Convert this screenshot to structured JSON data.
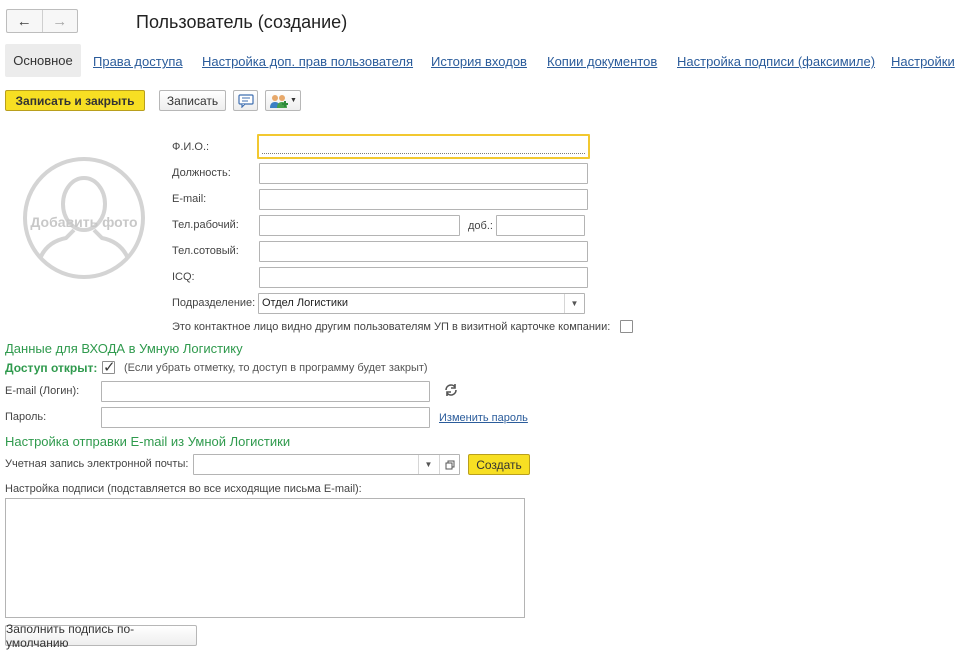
{
  "nav": {
    "back_icon": "←",
    "forward_icon": "→"
  },
  "title": "Пользователь (создание)",
  "tabs": [
    {
      "label": "Основное"
    },
    {
      "label": "Права доступа"
    },
    {
      "label": "Настройка доп. прав пользователя"
    },
    {
      "label": "История входов"
    },
    {
      "label": "Копии документов"
    },
    {
      "label": "Настройка подписи (факсимиле)"
    },
    {
      "label": "Настройки"
    }
  ],
  "toolbar": {
    "save_close_label": "Записать и закрыть",
    "save_label": "Записать"
  },
  "photo": {
    "label": "Добавить фото"
  },
  "form": {
    "fio_label": "Ф.И.О.:",
    "position_label": "Должность:",
    "email_label": "E-mail:",
    "work_phone_label": "Тел.рабочий:",
    "ext_label": "доб.:",
    "mobile_label": "Тел.сотовый:",
    "icq_label": "ICQ:",
    "department_label": "Подразделение:",
    "department_value": "Отдел Логистики",
    "visible_label": "Это контактное лицо видно другим пользователям УП в визитной карточке компании:"
  },
  "login_section": {
    "title": "Данные для ВХОДА в Умную Логистику",
    "access_label": "Доступ открыт:",
    "access_checked": true,
    "access_hint": "(Если убрать отметку, то доступ в программу будет закрыт)",
    "login_label": "E-mail (Логин):",
    "password_label": "Пароль:",
    "change_password_link": "Изменить пароль"
  },
  "email_section": {
    "title": "Настройка отправки E-mail из Умной Логистики",
    "account_label": "Учетная запись электронной почты:",
    "create_button": "Создать",
    "signature_label": "Настройка подписи (подставляется во все исходящие письма E-mail):",
    "fill_default_button": "Заполнить подпись по-умолчанию"
  },
  "colors": {
    "accent_yellow": "#f7df23",
    "section_green": "#2f9a4d",
    "link_blue": "#2b5c9b"
  }
}
